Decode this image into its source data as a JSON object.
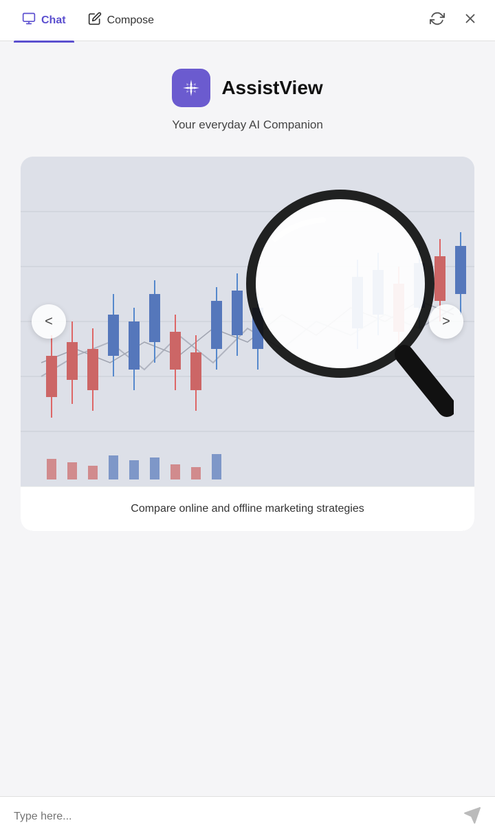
{
  "header": {
    "tabs": [
      {
        "id": "chat",
        "label": "Chat",
        "active": true,
        "icon": "chat-icon"
      },
      {
        "id": "compose",
        "label": "Compose",
        "active": false,
        "icon": "compose-icon"
      }
    ],
    "actions": [
      {
        "id": "refresh",
        "icon": "refresh-icon",
        "label": "Refresh"
      },
      {
        "id": "close",
        "icon": "close-icon",
        "label": "Close"
      }
    ]
  },
  "branding": {
    "app_name": "AssistView",
    "tagline": "Your everyday AI Companion"
  },
  "carousel": {
    "caption": "Compare online and offline marketing strategies",
    "prev_label": "<",
    "next_label": ">"
  },
  "input": {
    "placeholder": "Type here..."
  },
  "colors": {
    "brand_purple": "#6b5bcf",
    "brand_purple_dark": "#5b4fcf"
  }
}
